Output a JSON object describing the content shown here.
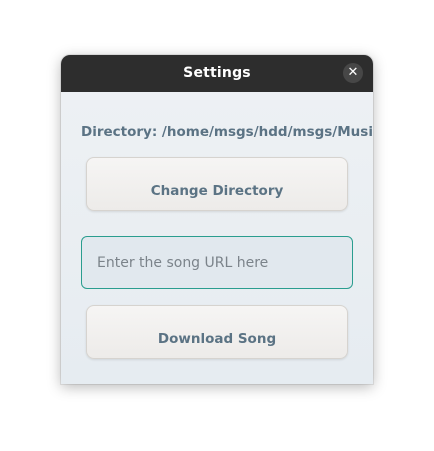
{
  "window": {
    "title": "Settings",
    "close_icon": "close-icon",
    "close_glyph": "✕"
  },
  "directory": {
    "label": "Directory: /home/msgs/hdd/msgs/Music"
  },
  "buttons": {
    "change_directory": "Change Directory",
    "download_song": "Download Song"
  },
  "url_input": {
    "value": "",
    "placeholder": "Enter the song URL here"
  },
  "colors": {
    "titlebar": "#2d2d2d",
    "accent": "#2a9d8f",
    "label_text": "#5b7384"
  }
}
